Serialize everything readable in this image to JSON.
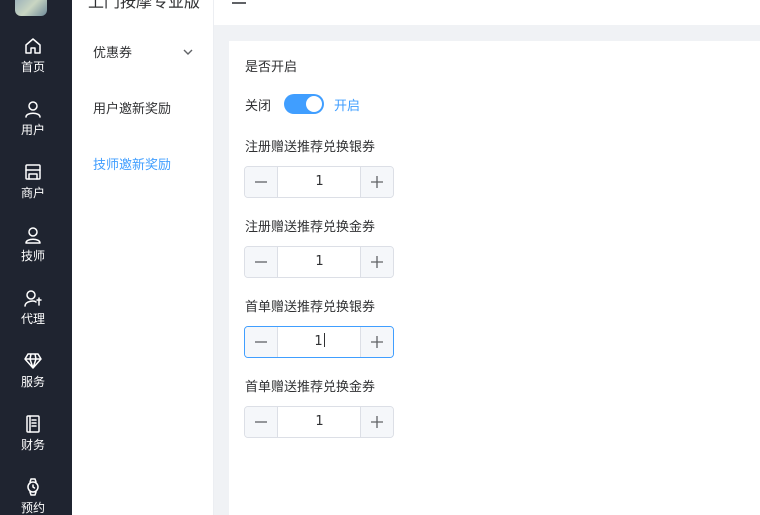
{
  "app": {
    "title": "上门按摩专业版"
  },
  "rail": {
    "items": [
      {
        "label": "首页",
        "icon": "home-icon"
      },
      {
        "label": "用户",
        "icon": "user-icon"
      },
      {
        "label": "商户",
        "icon": "shop-icon"
      },
      {
        "label": "技师",
        "icon": "person-icon"
      },
      {
        "label": "代理",
        "icon": "agent-icon"
      },
      {
        "label": "服务",
        "icon": "diamond-icon"
      },
      {
        "label": "财务",
        "icon": "ledger-icon"
      },
      {
        "label": "预约",
        "icon": "watch-icon"
      }
    ]
  },
  "submenu": {
    "items": [
      {
        "label": "优惠券"
      },
      {
        "label": "用户邀新奖励"
      },
      {
        "label": "技师邀新奖励"
      }
    ]
  },
  "form": {
    "enable_label": "是否开启",
    "switch": {
      "off_label": "关闭",
      "on_label": "开启",
      "value": true
    },
    "fields": [
      {
        "label": "注册赠送推荐兑换银券",
        "value": "1"
      },
      {
        "label": "注册赠送推荐兑换金券",
        "value": "1"
      },
      {
        "label": "首单赠送推荐兑换银券",
        "value": "1"
      },
      {
        "label": "首单赠送推荐兑换金券",
        "value": "1"
      }
    ]
  },
  "colors": {
    "primary": "#409eff",
    "rail_bg": "#1f2430"
  }
}
